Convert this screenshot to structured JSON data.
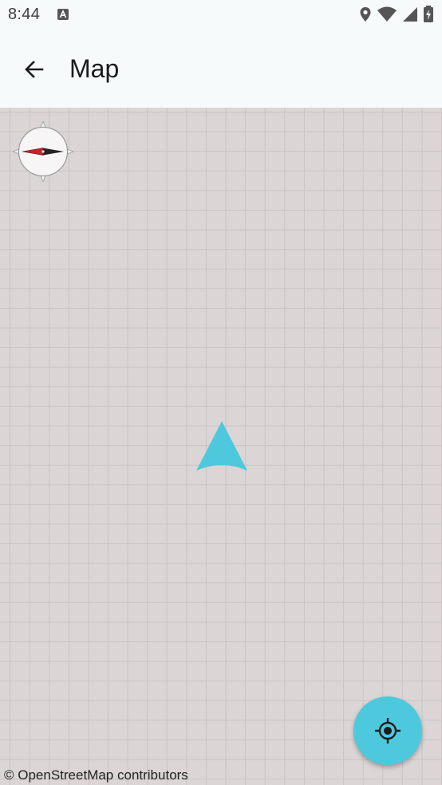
{
  "status_bar": {
    "time": "8:44",
    "icons": [
      "notification-a-icon",
      "location-icon",
      "wifi-icon",
      "signal-icon",
      "battery-charging-icon"
    ]
  },
  "app_bar": {
    "back_icon": "arrow-left-icon",
    "title": "Map"
  },
  "map": {
    "attribution": "© OpenStreetMap contributors",
    "compass_icon": "compass-icon",
    "location_marker_icon": "navigation-arrow-icon",
    "my_location_icon": "crosshair-location-icon"
  },
  "colors": {
    "accent": "#4ec8dd",
    "map_background": "#dbd5d6",
    "map_grid": "#cbc3c5",
    "compass_north": "#c0262c",
    "surface": "#f6fafa"
  }
}
